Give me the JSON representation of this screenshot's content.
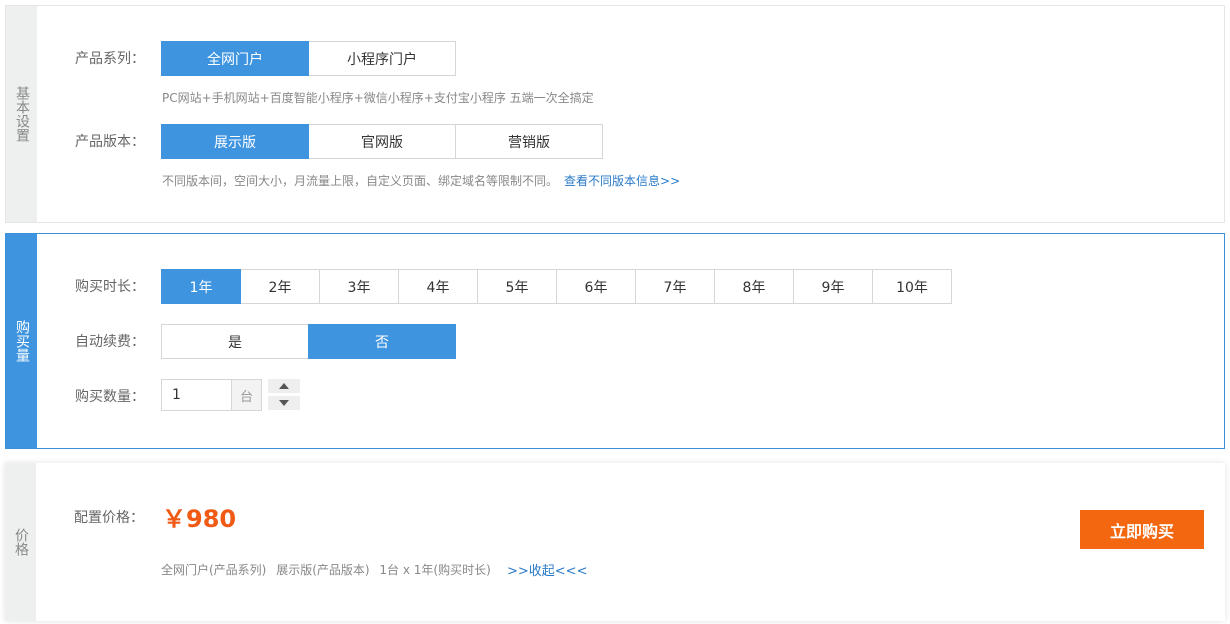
{
  "basic": {
    "side_label": "基本设置",
    "series_label": "产品系列：",
    "series_options": [
      "全网门户",
      "小程序门户"
    ],
    "series_selected": "全网门户",
    "series_hint": "PC网站+手机网站+百度智能小程序+微信小程序+支付宝小程序 五端一次全搞定",
    "version_label": "产品版本：",
    "version_options": [
      "展示版",
      "官网版",
      "营销版"
    ],
    "version_selected": "展示版",
    "version_hint": "不同版本间，空间大小，月流量上限，自定义页面、绑定域名等限制不同。",
    "version_link": "查看不同版本信息>>"
  },
  "buy": {
    "side_label": "购买量",
    "duration_label": "购买时长：",
    "duration_options": [
      "1年",
      "2年",
      "3年",
      "4年",
      "5年",
      "6年",
      "7年",
      "8年",
      "9年",
      "10年"
    ],
    "duration_selected": "1年",
    "renew_label": "自动续费：",
    "renew_options": [
      "是",
      "否"
    ],
    "renew_selected": "否",
    "quantity_label": "购买数量：",
    "quantity_value": "1",
    "quantity_unit": "台"
  },
  "price": {
    "side_label": "价格",
    "label": "配置价格：",
    "value": "￥980",
    "summary_series": "全网门户(产品系列)",
    "summary_version": "展示版(产品版本)",
    "summary_duration": "1台 x 1年(购买时长)",
    "collapse_link": ">>收起<<<",
    "buy_button": "立即购买"
  },
  "colors": {
    "accent": "#3f94e0",
    "price": "#f05a14",
    "buy_button": "#f2670f",
    "link": "#2a7ac8"
  },
  "icons": {
    "step_up": "triangle-up-icon",
    "step_down": "triangle-down-icon"
  }
}
